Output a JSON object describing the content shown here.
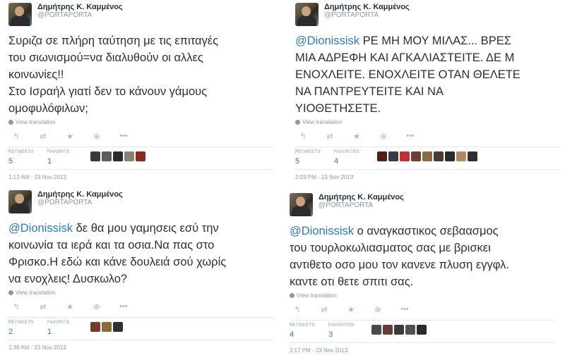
{
  "colors": {
    "link": "#2b7bb9",
    "muted": "#8899a6",
    "text": "#292f33"
  },
  "tweets": [
    {
      "name": "Δημήτρης Κ. Καμμένος",
      "handle": "@PORTAPORTA",
      "mention": "",
      "text": "Συριζα σε πλήρη ταύτηση με τις επιταγές\nτου σιωνισμού=να διαλυθούν οι αλλες\nκοινωνίες!!\nΣτο Ισραήλ γιατί δεν το κάνουν γάμους\nομοφυλόφιλων;",
      "view_translation": "View translation",
      "actions": [
        "reply-icon",
        "retweet-icon",
        "favorite-icon",
        "follow-icon",
        "more-icon"
      ],
      "retweets_label": "RETWEETS",
      "retweets": "5",
      "favorites_label": "FAVORITE",
      "favorites": "1",
      "faces": [
        "#3a3a3a",
        "#5c5c5c",
        "#2a2a2a",
        "#888070",
        "#8a2a1e"
      ],
      "time": "1:12 AM - 23 Nov 2013"
    },
    {
      "name": "Δημήτρης Κ. Καμμένος",
      "handle": "@PORTAPORTA",
      "mention": "@Dionissisk",
      "text": " ΡΕ ΜΗ ΜΟΥ ΜΙΛΑΣ... ΒΡΕΣ\nΜΙΑ ΑΔΡΕΦΗ ΚΑΙ ΑΓΚΑΛΙΑΣΤΕΙΤΕ. ΔΕ Μ\nΕΝΟΧΛΕΙΤΕ. ΕΝΟΧΛΕΙΤΕ ΟΤΑΝ ΘΕΛΕΤΕ\nΝΑ ΠΑΝΤΡΕΥΤΕΙΤΕ ΚΑΙ ΝΑ\nΥΙΟΘΕΤΗΣΕΤΕ.",
      "view_translation": "View translation",
      "actions": [
        "reply-icon",
        "retweet-icon",
        "favorite-icon",
        "follow-icon",
        "more-icon"
      ],
      "retweets_label": "RETWEETS",
      "retweets": "5",
      "favorites_label": "FAVORITES",
      "favorites": "4",
      "faces": [
        "#5a1a1a",
        "#3a3a40",
        "#c03030",
        "#6a4030",
        "#8a6a40",
        "#4a3a30",
        "#2a2a2a",
        "#b08a60",
        "#303030"
      ],
      "time": "2:03 PM - 23 Nov 2013"
    },
    {
      "name": "Δημήτρης Κ. Καμμένος",
      "handle": "@PORTAPORTA",
      "mention": "@Dionissisk",
      "text": " δε θα μου γαμησεις εσύ την\nκοινωνία τα ιερά και τα οσια.Να πας στο\nΦρισκο.Η εδώ και κάνε δουλειά σού χωρίς\nνα ενοχλεις! Δυσκωλο?",
      "view_translation": "View translation",
      "actions": [
        "reply-icon",
        "retweet-icon",
        "favorite-icon",
        "follow-icon",
        "more-icon"
      ],
      "retweets_label": "RETWEETS",
      "retweets": "2",
      "favorites_label": "FAVORITE",
      "favorites": "1",
      "faces": [
        "#7a3a2a",
        "#8a6a3a",
        "#303030"
      ],
      "time": "1:36 AM - 23 Nov 2013"
    },
    {
      "name": "Δημήτρης Κ. Καμμένος",
      "handle": "@PORTAPORTA",
      "mention": "@Dionissisk",
      "text": " ο αναγκαστικος σεβαασμος\nτου τουρλοκωλιασματος σας με βρισκει\nαντιθετο οσο μου τον κανενε πλυση εγγφλ.\nκαντε οτι θετε σπιτι σας.",
      "view_translation": "View translation",
      "actions": [
        "reply-icon",
        "retweet-icon",
        "favorite-icon",
        "follow-icon",
        "more-icon"
      ],
      "retweets_label": "RETWEETS",
      "retweets": "4",
      "favorites_label": "FAVORITES",
      "favorites": "3",
      "faces": [
        "#4a4a4a",
        "#6a3a3a",
        "#3a3a3a",
        "#505050",
        "#2a2a2a"
      ],
      "time": "2:17 PM - 23 Nov 2013"
    }
  ]
}
